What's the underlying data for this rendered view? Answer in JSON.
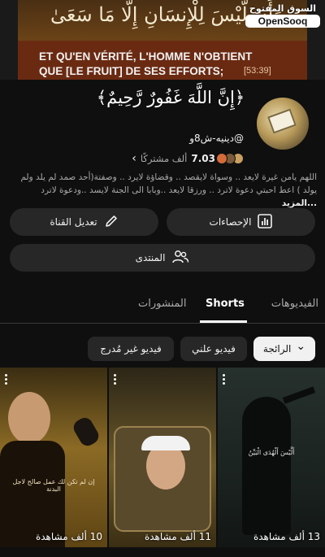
{
  "banner": {
    "arabic_verse": "وَأَن لَّيْسَ لِلْإِنسَانِ إِلَّا مَا سَعَىٰ",
    "french_line1": "ET QU'EN VÉRITÉ, L'HOMME N'OBTIENT",
    "french_line2": "QUE [LE FRUIT] DE SES EFFORTS;",
    "verse_ref": "[53:39]"
  },
  "watermark": {
    "arabic": "السوق المفتوح",
    "english": "OpenSooq"
  },
  "channel": {
    "title": "﴿إِنَّ اللَّهَ غَفُورٌ رَّحِيمٌ﴾",
    "handle": "@دينيه-ش8و",
    "subscribers": "7.03",
    "subscribers_suffix": "ألف مشتركًا",
    "chevron": "›",
    "description": "اللهم يامن غيرة لايعد .. وسواة لايقصد .. وقضاؤة لايرد .. وصفتة(أحد صمد لم يلد ولم يولد ) اعط احبتي دعوة لاترد .. ورزقا لايعد ..وبابا الى الجنة لايسد ..ودعوة لاترد",
    "more": "...المزيد"
  },
  "buttons": {
    "stats": "الإحصاءات",
    "edit": "تعديل القناة",
    "forum": "المنتدى"
  },
  "tabs": [
    {
      "label": "الفيديوهات"
    },
    {
      "label": "Shorts"
    },
    {
      "label": "المنشورات"
    }
  ],
  "chips": {
    "sort": "الرائجة",
    "sort_arrow": "⌄",
    "listed": "فيديو علني",
    "unlisted": "فيديو غير مُدرج"
  },
  "shorts": [
    {
      "views": "13 ألف مشاهدة",
      "overlay_text": "أَلَّيْسَ أَلْهُدَى الْبَيِّنُ"
    },
    {
      "views": "11 ألف مشاهدة"
    },
    {
      "views": "10 ألف مشاهدة",
      "overlay_text": "إن لم تكن لك عمل صالح لاجل البدنة"
    }
  ],
  "colors": {
    "background": "#0f0f0f",
    "chip": "#272727",
    "accent": "#f1f1f1"
  }
}
